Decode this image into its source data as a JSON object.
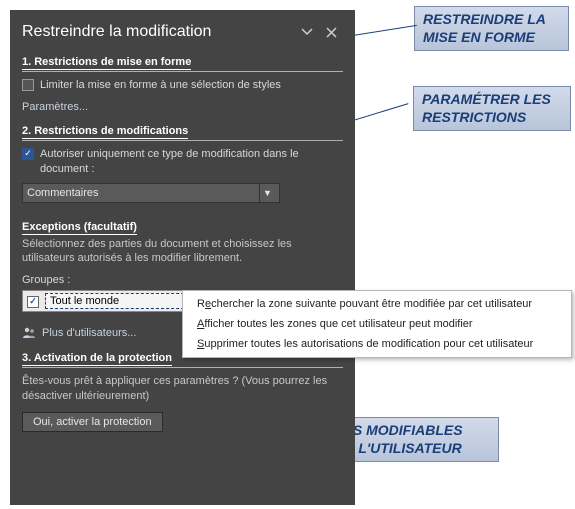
{
  "panel": {
    "title": "Restreindre la modification",
    "section1": {
      "header": "1. Restrictions de mise en forme",
      "check_label": "Limiter la mise en forme à une sélection de styles",
      "params_link": "Paramètres..."
    },
    "section2": {
      "header": "2. Restrictions de modifications",
      "check_label": "Autoriser uniquement ce type de modification dans le document :",
      "dropdown_value": "Commentaires"
    },
    "exceptions": {
      "title": "Exceptions (facultatif)",
      "desc": "Sélectionnez des parties du document et choisissez les utilisateurs autorisés à les modifier librement.",
      "groups_label": "Groupes :",
      "group_item": "Tout le monde",
      "more_users": "Plus d'utilisateurs..."
    },
    "section3": {
      "header": "3. Activation de la protection",
      "desc": "Êtes-vous prêt à appliquer ces paramètres ? (Vous pourrez les désactiver ultérieurement)",
      "button": "Oui, activer la protection"
    }
  },
  "context_menu": {
    "item1_pre": "R",
    "item1_u": "e",
    "item1_post": "chercher la zone suivante pouvant être modifiée par cet utilisateur",
    "item2_pre": "",
    "item2_u": "A",
    "item2_post": "fficher toutes les zones que cet utilisateur peut modifier",
    "item3_pre": "",
    "item3_u": "S",
    "item3_post": "upprimer toutes les autorisations de modification pour cet utilisateur"
  },
  "callouts": {
    "c1": "RESTREINDRE LA MISE EN FORME",
    "c2": "PARAMÉTRER LES RESTRICTIONS",
    "c3": "ZONES MODIFIABLES POUR L'UTILISATEUR"
  }
}
